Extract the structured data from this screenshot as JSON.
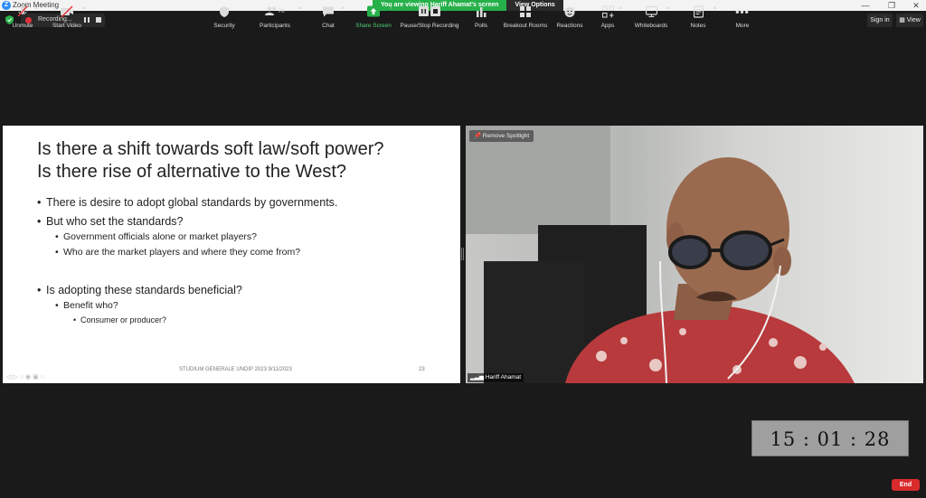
{
  "window": {
    "title": "Zoom Meeting",
    "viewing_banner": "You are viewing Hariff Ahamat's screen",
    "view_options": "View Options",
    "sign_in": "Sign in",
    "view": "View"
  },
  "recording": {
    "status": "Recording..."
  },
  "slide": {
    "title_line1": "Is there a shift towards soft law/soft power?",
    "title_line2": "Is there rise of alternative to the West?",
    "bullets": {
      "b1": "There is desire to adopt global standards by governments.",
      "b2": "But who set the standards?",
      "b2a": "Government officials alone or market players?",
      "b2b": "Who are the market players and where they come from?",
      "b3": "Is adopting these standards beneficial?",
      "b3a": "Benefit who?",
      "b3a1": "Consumer or producer?"
    },
    "footer": "STUDIUM GENERALE UNDIP 2023 9/11/2023",
    "page_number": "23"
  },
  "video": {
    "remove_spotlight": "Remove Spotlight",
    "participant_name": "Hariff Ahamat"
  },
  "timer": {
    "value": "15 : 01 : 28"
  },
  "toolbar": {
    "unmute": "Unmute",
    "start_video": "Start Video",
    "security": "Security",
    "participants": "Participants",
    "participants_count": "70",
    "chat": "Chat",
    "share_screen": "Share Screen",
    "pause_stop_recording": "Pause/Stop Recording",
    "polls": "Polls",
    "breakout_rooms": "Breakout Rooms",
    "reactions": "Reactions",
    "apps": "Apps",
    "whiteboards": "Whiteboards",
    "notes": "Notes",
    "more": "More",
    "end": "End"
  },
  "colors": {
    "share_green": "#26b04a",
    "end_red": "#d92b2b",
    "record_red": "#e2333b",
    "background": "#1a1a1a"
  }
}
